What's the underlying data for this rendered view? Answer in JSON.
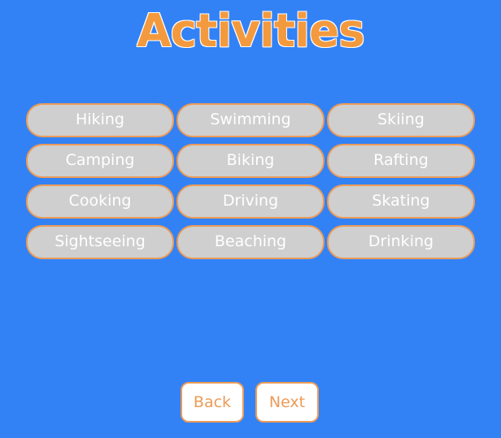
{
  "page": {
    "title": "Activities"
  },
  "activities": [
    {
      "label": "Hiking"
    },
    {
      "label": "Swimming"
    },
    {
      "label": "Skiing"
    },
    {
      "label": "Camping"
    },
    {
      "label": "Biking"
    },
    {
      "label": "Rafting"
    },
    {
      "label": "Cooking"
    },
    {
      "label": "Driving"
    },
    {
      "label": "Skating"
    },
    {
      "label": "Sightseeing"
    },
    {
      "label": "Beaching"
    },
    {
      "label": "Drinking"
    }
  ],
  "navigation": {
    "back_label": "Back",
    "next_label": "Next"
  },
  "colors": {
    "background": "#3282f6",
    "accent": "#ec9b57",
    "pill_fill": "#cfcfcf",
    "button_fill": "#ffffff"
  }
}
